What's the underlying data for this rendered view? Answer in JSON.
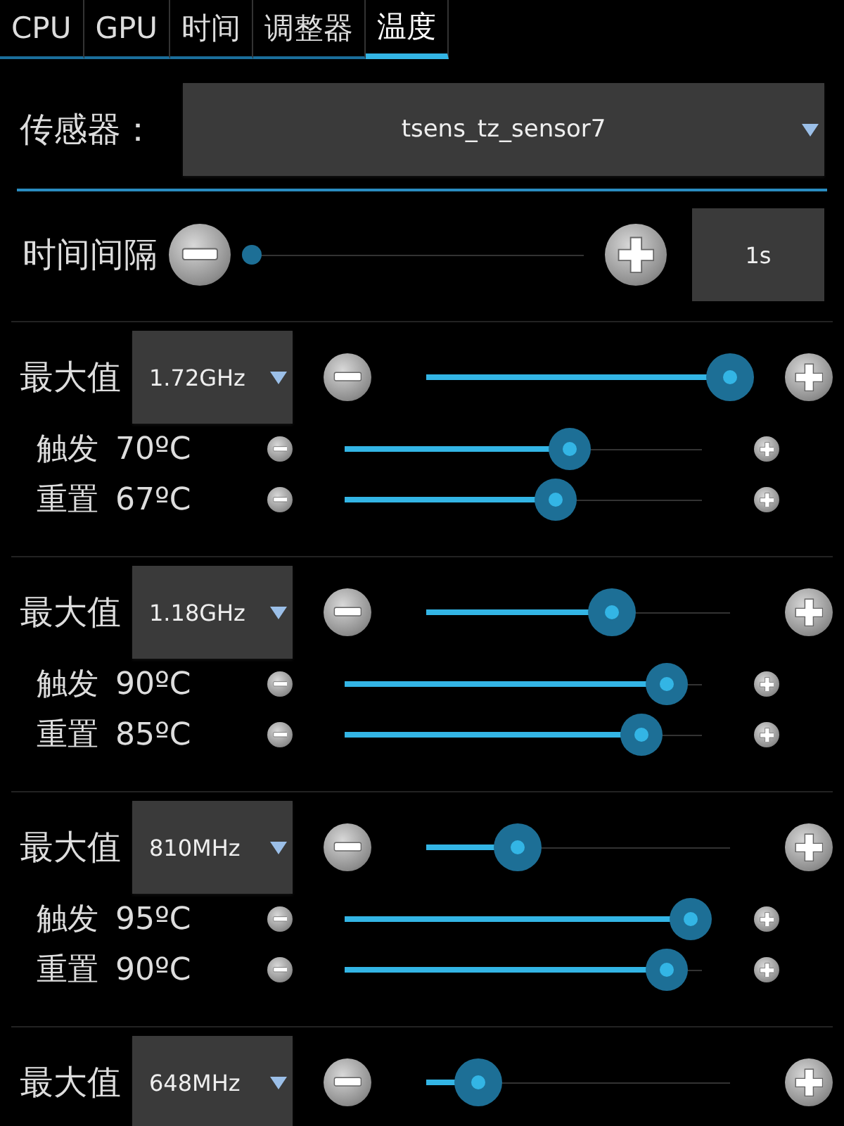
{
  "tabs": [
    {
      "label": "CPU",
      "selected": false
    },
    {
      "label": "GPU",
      "selected": false
    },
    {
      "label": "时间",
      "selected": false
    },
    {
      "label": "调整器",
      "selected": false
    },
    {
      "label": "温度",
      "selected": true
    }
  ],
  "sensor": {
    "label": "传感器：",
    "value": "tsens_tz_sensor7"
  },
  "interval": {
    "label": "时间间隔",
    "level": 0,
    "value": "1s"
  },
  "profiles": [
    {
      "max_label": "最大值",
      "frequency": "1.72GHz",
      "level": 1,
      "thresholds": [
        {
          "label": "触发",
          "reading": "70ºC",
          "level": 0.63
        },
        {
          "label": "重置",
          "reading": "67ºC",
          "level": 0.59
        }
      ]
    },
    {
      "max_label": "最大值",
      "frequency": "1.18GHz",
      "level": 0.61,
      "thresholds": [
        {
          "label": "触发",
          "reading": "90ºC",
          "level": 0.9
        },
        {
          "label": "重置",
          "reading": "85ºC",
          "level": 0.83
        }
      ]
    },
    {
      "max_label": "最大值",
      "frequency": "810MHz",
      "level": 0.3,
      "thresholds": [
        {
          "label": "触发",
          "reading": "95ºC",
          "level": 0.97
        },
        {
          "label": "重置",
          "reading": "90ºC",
          "level": 0.9
        }
      ]
    },
    {
      "max_label": "最大值",
      "frequency": "648MHz",
      "level": 0.17
    }
  ]
}
